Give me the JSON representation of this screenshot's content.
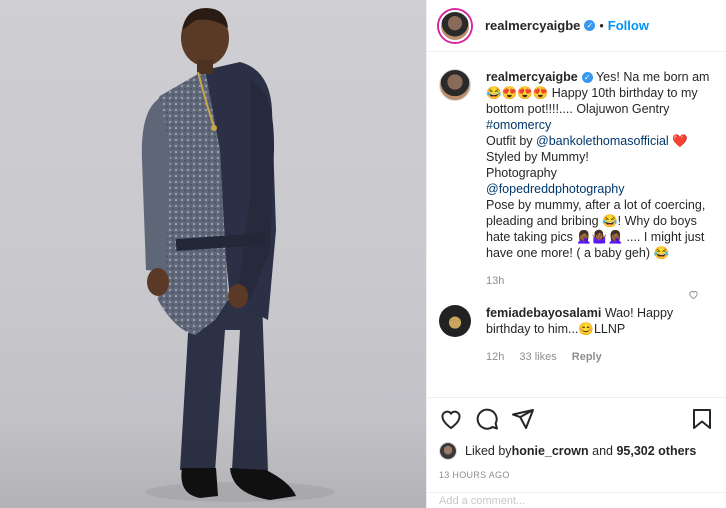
{
  "header": {
    "username": "realmercyaigbe",
    "separator": "•",
    "follow_label": "Follow"
  },
  "caption": {
    "username": "realmercyaigbe",
    "text_1": "Yes! Na me born am 😂😍😍😍 Happy 10th birthday to my bottom pot!!!!.... Olajuwon Gentry ",
    "hashtag": "#omomercy",
    "text_2": "Outfit by ",
    "mention_1": "@bankolethomasofficial",
    "text_3": " ❤️",
    "text_4": "Styled by Mummy!",
    "text_5": "Photography",
    "mention_2": "@fopedreddphotography",
    "text_6": "Pose by mummy, after a lot of coercing, pleading and bribing 😂! Why do boys hate taking pics 🤦🏾‍♀️🤷🏾‍♀️🤦🏾‍♀️ .... I might just have one more! ( a baby geh) 😂",
    "time": "13h"
  },
  "comment": {
    "username": "femiadebayosalami",
    "text": "Wao! Happy birthday to him...😊LLNP",
    "time": "12h",
    "likes": "33 likes",
    "reply_label": "Reply"
  },
  "likes": {
    "prefix": "Liked by ",
    "liker": "honie_crown",
    "middle": " and ",
    "count": "95,302 others"
  },
  "timestamp": "13 HOURS AGO",
  "add_comment_placeholder": "Add a comment...",
  "icons": [
    "heart-icon",
    "comment-icon",
    "share-icon",
    "bookmark-icon",
    "verified-icon"
  ],
  "colors": {
    "accent": "#0095f6",
    "verified": "#3897f0",
    "text": "#262626",
    "muted": "#8e8e8e"
  }
}
